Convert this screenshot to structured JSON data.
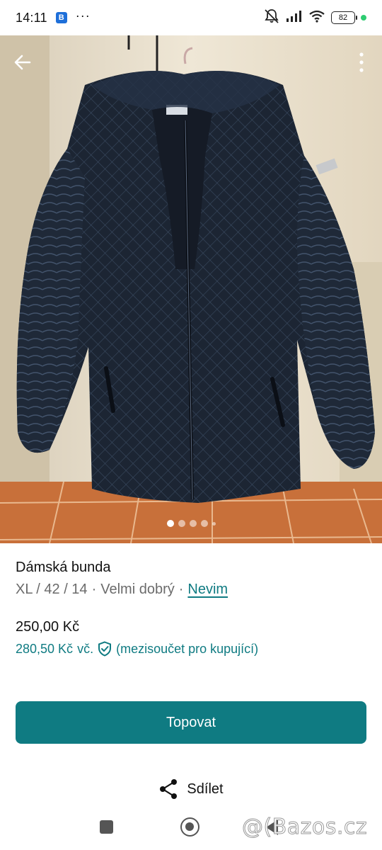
{
  "status_bar": {
    "time": "14:11",
    "app_badge": "B",
    "more": "···",
    "battery": "82",
    "icons": [
      "mute-icon",
      "signal-icon",
      "wifi-icon"
    ]
  },
  "gallery": {
    "total_images": 5,
    "active_index": 0,
    "back_icon": "arrow-back-icon",
    "menu_icon": "more-vert-icon"
  },
  "listing": {
    "title": "Dámská bunda",
    "size": "XL / 42 / 14",
    "separator": "·",
    "condition": "Velmi dobrý",
    "brand": "Nevim",
    "price": "250,00 Kč",
    "buyer_price": "280,50 Kč",
    "buyer_price_suffix": "vč.",
    "buyer_note": "(mezisoučet pro kupující)"
  },
  "actions": {
    "primary": "Topovat",
    "share": "Sdílet"
  },
  "watermark": "@(Bazos.cz",
  "colors": {
    "accent": "#0f7b82",
    "text_muted": "#6b6b6b"
  }
}
